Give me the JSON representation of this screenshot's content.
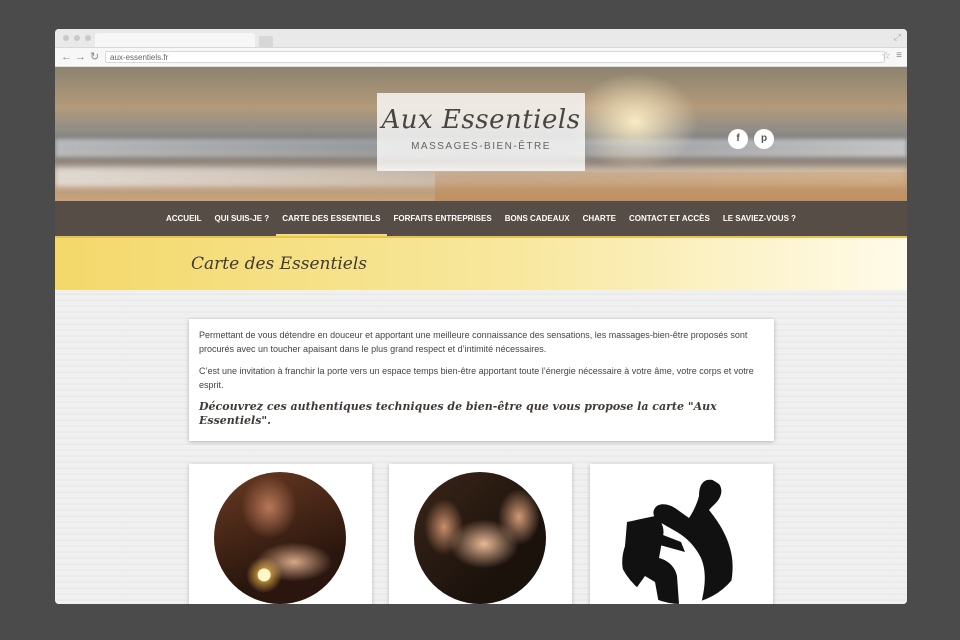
{
  "browser": {
    "url": "aux-essentiels.fr"
  },
  "header": {
    "logo_title": "Aux Essentiels",
    "logo_subtitle": "MASSAGES-BIEN-ÊTRE",
    "social": [
      {
        "icon": "facebook-icon",
        "label": "f"
      },
      {
        "icon": "pinterest-icon",
        "label": "p"
      }
    ]
  },
  "nav": {
    "items": [
      "ACCUEIL",
      "QUI SUIS-JE ?",
      "CARTE DES ESSENTIELS",
      "FORFAITS ENTREPRISES",
      "BONS CADEAUX",
      "CHARTE",
      "CONTACT ET ACCÈS",
      "LE SAVIEZ-VOUS ?"
    ],
    "active_index": 2
  },
  "page": {
    "title": "Carte des Essentiels",
    "intro_p1": "Permettant de vous détendre en douceur et apportant une meilleure connaissance des sensations, les massages-bien-être proposés sont procurés avec un toucher apaisant dans le plus grand respect et d’intimité nécessaires.",
    "intro_p2": "C’est une invitation à franchir la porte vers un espace temps bien-être apportant toute l’énergie nécessaire à votre âme, votre corps et votre esprit.",
    "intro_quote": "Découvrez ces authentiques techniques de bien-être que vous propose la carte \"Aux Essentiels\"."
  },
  "colors": {
    "nav_bg": "#564d46",
    "banner_yellow": "#f3d86a",
    "accent": "#f4dc7a"
  }
}
